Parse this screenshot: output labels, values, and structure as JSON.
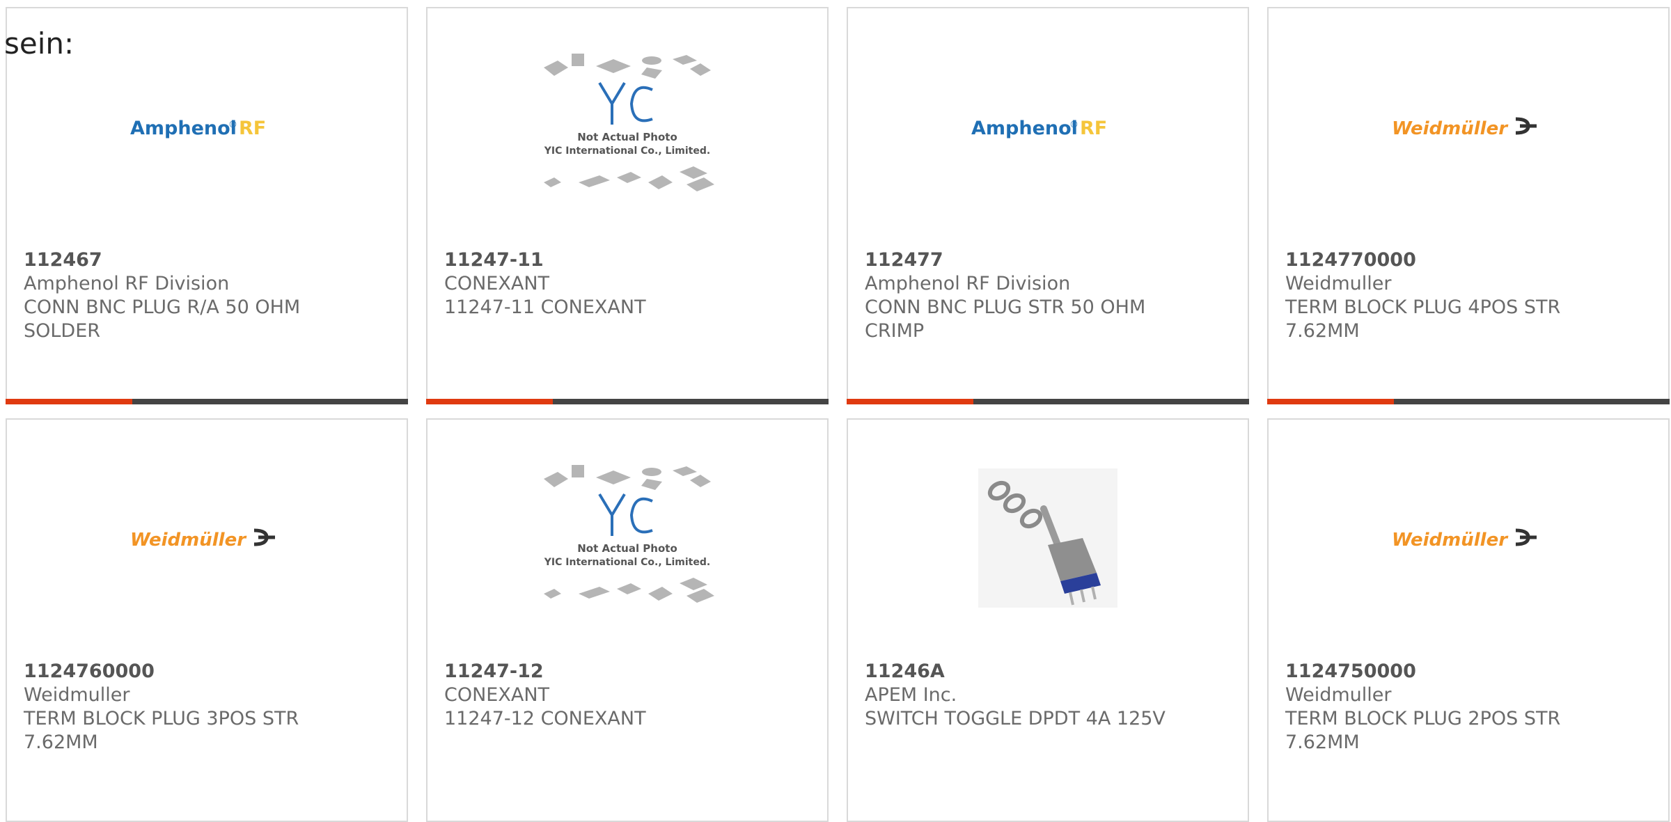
{
  "intro_text": "sein:",
  "colors": {
    "accent_bar": "#e03a10",
    "bar_dark": "#444444",
    "amphenol_blue": "#1f6fb4",
    "amphenol_yellow": "#f5c53a",
    "weidmuller_orange": "#f29425"
  },
  "products": [
    {
      "part_number": "112467",
      "manufacturer": "Amphenol RF Division",
      "desc1": "CONN BNC PLUG R/A 50 OHM",
      "desc2": "SOLDER",
      "image": "amphenol-rf-logo"
    },
    {
      "part_number": "11247-11",
      "manufacturer": "CONEXANT",
      "desc1": "11247-11 CONEXANT",
      "desc2": "",
      "image": "yic-not-actual-photo",
      "img_text1": "Not Actual Photo",
      "img_text2": "YIC International Co., Limited."
    },
    {
      "part_number": "112477",
      "manufacturer": "Amphenol RF Division",
      "desc1": "CONN BNC PLUG STR 50 OHM",
      "desc2": "CRIMP",
      "image": "amphenol-rf-logo"
    },
    {
      "part_number": "1124770000",
      "manufacturer": "Weidmuller",
      "desc1": "TERM BLOCK PLUG 4POS STR",
      "desc2": "7.62MM",
      "image": "weidmuller-logo"
    },
    {
      "part_number": "1124760000",
      "manufacturer": "Weidmuller",
      "desc1": "TERM BLOCK PLUG 3POS STR",
      "desc2": "7.62MM",
      "image": "weidmuller-logo"
    },
    {
      "part_number": "11247-12",
      "manufacturer": "CONEXANT",
      "desc1": "11247-12 CONEXANT",
      "desc2": "",
      "image": "yic-not-actual-photo",
      "img_text1": "Not Actual Photo",
      "img_text2": "YIC International Co., Limited."
    },
    {
      "part_number": "11246A",
      "manufacturer": "APEM Inc.",
      "desc1": "SWITCH TOGGLE DPDT 4A 125V",
      "desc2": "",
      "image": "toggle-switch-photo"
    },
    {
      "part_number": "1124750000",
      "manufacturer": "Weidmuller",
      "desc1": "TERM BLOCK PLUG 2POS STR",
      "desc2": "7.62MM",
      "image": "weidmuller-logo"
    }
  ],
  "logos": {
    "amphenol_main": "Amphenol",
    "amphenol_reg": "®",
    "amphenol_rf": "RF",
    "weidmuller": "Weidmüller"
  }
}
